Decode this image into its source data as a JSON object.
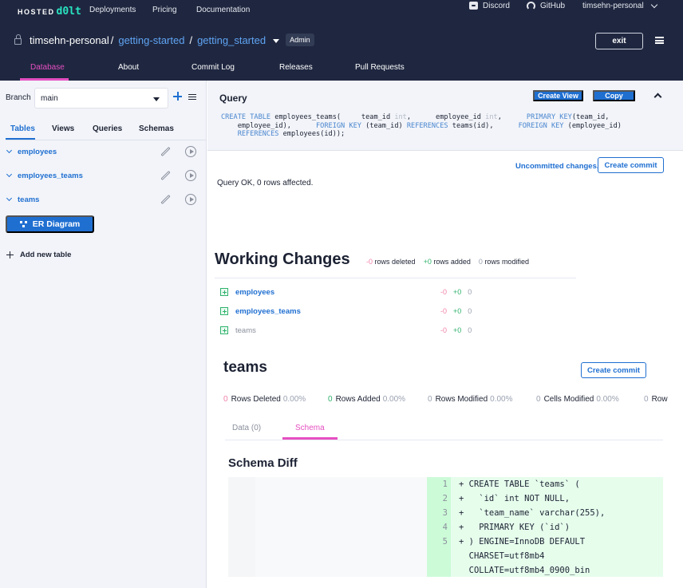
{
  "header": {
    "logo_prefix": "HOSTED",
    "logo_brand": "d0lt",
    "nav": [
      "Deployments",
      "Pricing",
      "Documentation"
    ],
    "links": {
      "discord": "Discord",
      "github": "GitHub",
      "user": "timsehn-personal"
    },
    "breadcrumb": {
      "owner": "timsehn-personal",
      "sep": "/",
      "deployment": "getting-started",
      "database": "getting_started"
    },
    "badge": "Admin",
    "exit_label": "exit",
    "tabs": [
      "Database",
      "About",
      "Commit Log",
      "Releases",
      "Pull Requests"
    ],
    "active_tab": "Database"
  },
  "sidebar": {
    "branch_label": "Branch",
    "branch_value": "main",
    "tabs": [
      "Tables",
      "Views",
      "Queries",
      "Schemas"
    ],
    "active_tab": "Tables",
    "tables": [
      "employees",
      "employees_teams",
      "teams"
    ],
    "er_button": "ER Diagram",
    "add_table": "Add new table"
  },
  "query": {
    "title": "Query",
    "create_view": "Create View",
    "copy": "Copy",
    "sql_lines": [
      "CREATE TABLE employees_teams(     team_id int,      employee_id int,      PRIMARY KEY(team_id,",
      "    employee_id),      FOREIGN KEY (team_id) REFERENCES teams(id),      FOREIGN KEY (employee_id)",
      "    REFERENCES employees(id));"
    ],
    "uncommitted": "Uncommitted changes.",
    "create_commit": "Create commit",
    "result": "Query OK, 0 rows affected."
  },
  "working_changes": {
    "title": "Working Changes",
    "deleted": "-0",
    "deleted_label": "rows deleted",
    "added": "+0",
    "added_label": "rows added",
    "modified": "0",
    "modified_label": "rows modified",
    "rows": [
      {
        "name": "employees",
        "deleted": "-0",
        "added": "+0",
        "modified": "0"
      },
      {
        "name": "employees_teams",
        "deleted": "-0",
        "added": "+0",
        "modified": "0"
      },
      {
        "name": "teams",
        "deleted": "-0",
        "added": "+0",
        "modified": "0"
      }
    ]
  },
  "table_diff": {
    "title": "teams",
    "create_commit": "Create commit",
    "stats": [
      {
        "n": "0",
        "label": "Rows Deleted",
        "pct": "0.00%"
      },
      {
        "n": "0",
        "label": "Rows Added",
        "pct": "0.00%"
      },
      {
        "n": "0",
        "label": "Rows Modified",
        "pct": "0.00%"
      },
      {
        "n": "0",
        "label": "Cells Modified",
        "pct": "0.00%"
      },
      {
        "n": "0",
        "label": "Row",
        "pct": ""
      }
    ],
    "tabs": [
      "Data (0)",
      "Schema"
    ],
    "active_tab": "Schema",
    "schema_diff_title": "Schema Diff",
    "diff_lines": [
      {
        "num": "1",
        "text": "+ CREATE TABLE `teams` ("
      },
      {
        "num": "2",
        "text": "+   `id` int NOT NULL,"
      },
      {
        "num": "3",
        "text": "+   `team_name` varchar(255),"
      },
      {
        "num": "4",
        "text": "+   PRIMARY KEY (`id`)"
      },
      {
        "num": "5",
        "text": "+ ) ENGINE=InnoDB DEFAULT"
      },
      {
        "num": "",
        "text": "  CHARSET=utf8mb4"
      },
      {
        "num": "",
        "text": "  COLLATE=utf8mb4_0900_bin"
      }
    ]
  },
  "colors": {
    "accent": "#1f6fd1",
    "pink": "#e54fc1",
    "header_bg": "#1f2740",
    "added": "#2fb26c",
    "deleted": "#f17fa8"
  }
}
